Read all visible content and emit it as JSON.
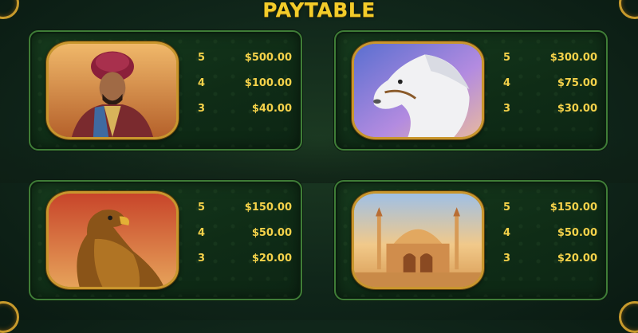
{
  "title": "PAYTABLE",
  "symbols": [
    {
      "icon": "sultan-symbol-icon",
      "payouts": [
        {
          "count": "5",
          "amount": "$500.00"
        },
        {
          "count": "4",
          "amount": "$100.00"
        },
        {
          "count": "3",
          "amount": "$40.00"
        }
      ]
    },
    {
      "icon": "white-horse-symbol-icon",
      "payouts": [
        {
          "count": "5",
          "amount": "$300.00"
        },
        {
          "count": "4",
          "amount": "$75.00"
        },
        {
          "count": "3",
          "amount": "$30.00"
        }
      ]
    },
    {
      "icon": "eagle-symbol-icon",
      "payouts": [
        {
          "count": "5",
          "amount": "$150.00"
        },
        {
          "count": "4",
          "amount": "$50.00"
        },
        {
          "count": "3",
          "amount": "$20.00"
        }
      ]
    },
    {
      "icon": "palace-symbol-icon",
      "payouts": [
        {
          "count": "5",
          "amount": "$150.00"
        },
        {
          "count": "4",
          "amount": "$50.00"
        },
        {
          "count": "3",
          "amount": "$20.00"
        }
      ]
    }
  ],
  "colors": {
    "title": "#f3cc2a",
    "payout_text": "#f5d24a",
    "panel_border": "#3f7d37",
    "frame_gold": "#c9962d"
  }
}
